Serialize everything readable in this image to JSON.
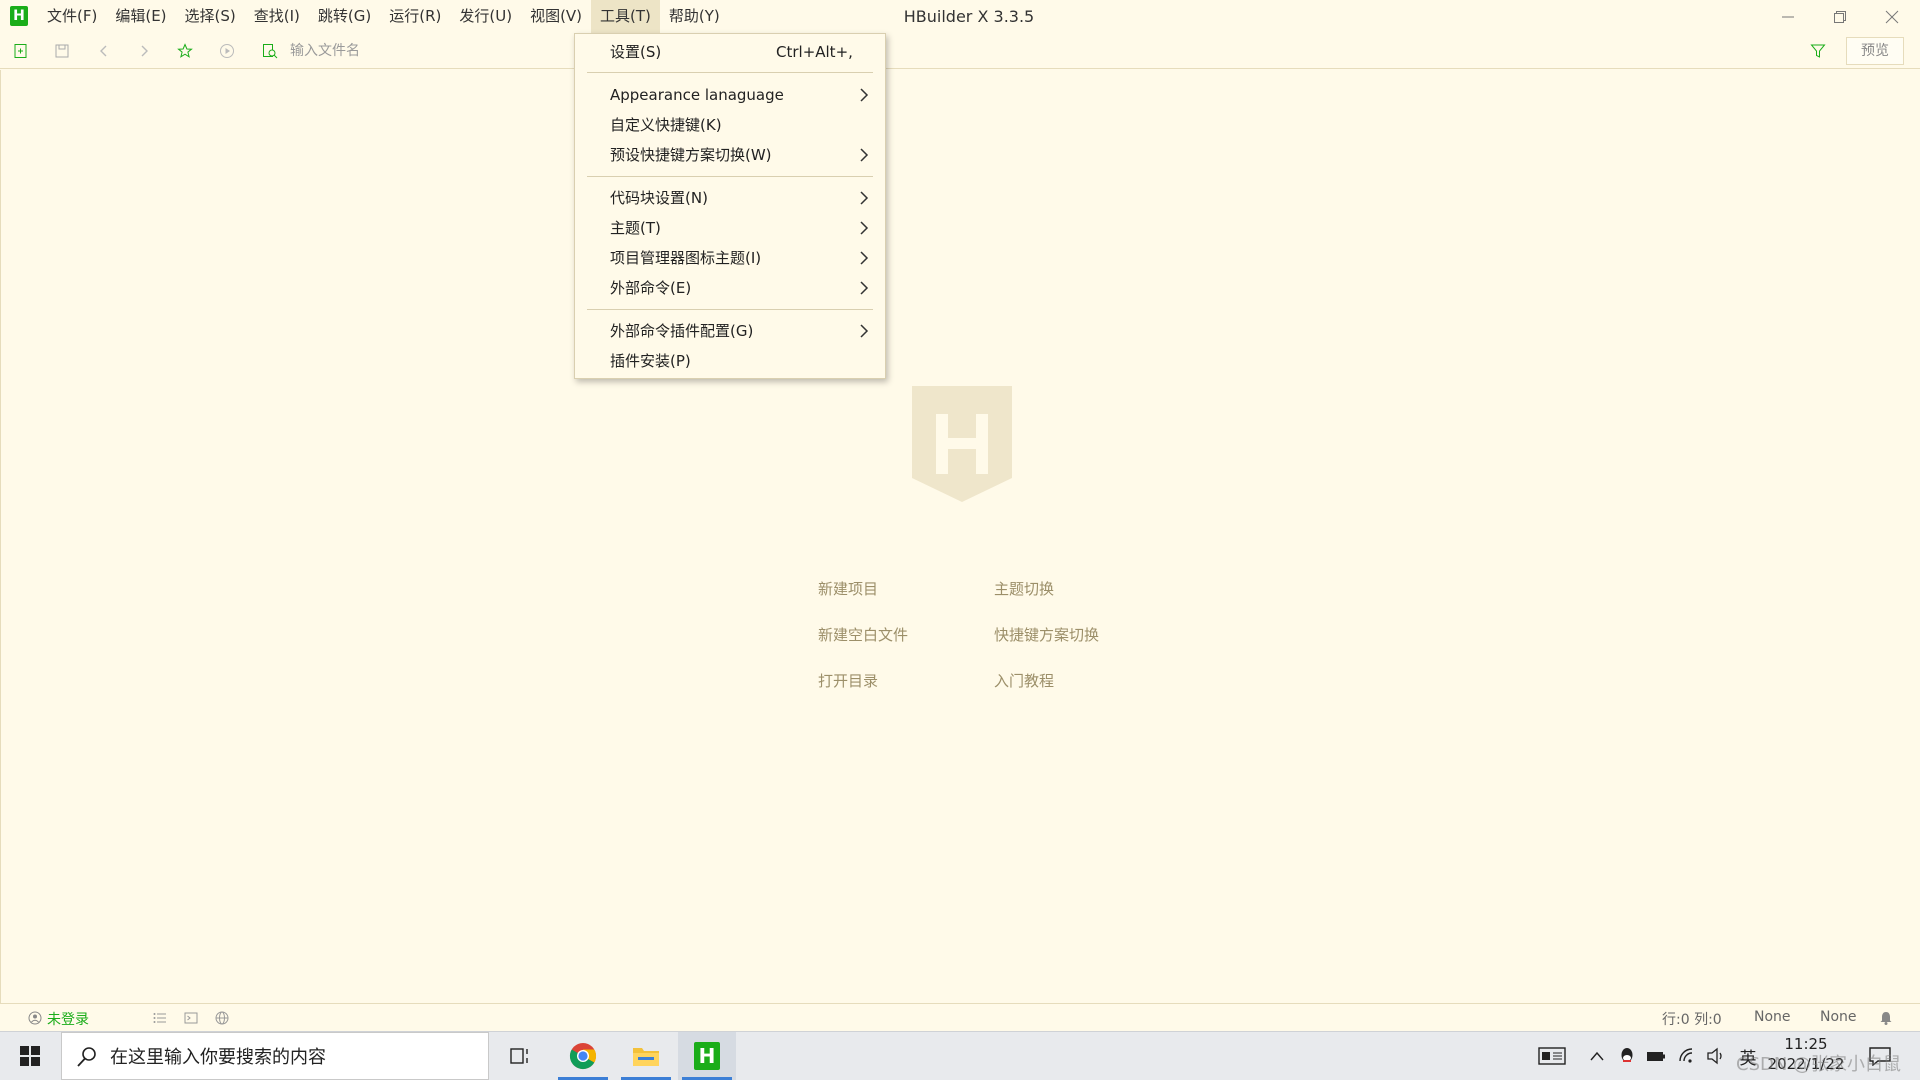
{
  "app": {
    "logo_letter": "H",
    "window_title": "HBuilder X 3.3.5"
  },
  "menubar": {
    "items": [
      {
        "label": "文件(F)"
      },
      {
        "label": "编辑(E)"
      },
      {
        "label": "选择(S)"
      },
      {
        "label": "查找(I)"
      },
      {
        "label": "跳转(G)"
      },
      {
        "label": "运行(R)"
      },
      {
        "label": "发行(U)"
      },
      {
        "label": "视图(V)"
      },
      {
        "label": "工具(T)",
        "active": true
      },
      {
        "label": "帮助(Y)"
      }
    ]
  },
  "toolbar": {
    "file_search_placeholder": "输入文件名",
    "preview_label": "预览"
  },
  "tools_menu": {
    "items": [
      {
        "label": "设置(S)",
        "shortcut": "Ctrl+Alt+,"
      },
      {
        "label": "Appearance lanaguage",
        "submenu": true
      },
      {
        "label": "自定义快捷键(K)"
      },
      {
        "label": "预设快捷键方案切换(W)",
        "submenu": true
      },
      {
        "label": "代码块设置(N)",
        "submenu": true
      },
      {
        "label": "主题(T)",
        "submenu": true
      },
      {
        "label": "项目管理器图标主题(I)",
        "submenu": true
      },
      {
        "label": "外部命令(E)",
        "submenu": true
      },
      {
        "label": "外部命令插件配置(G)",
        "submenu": true
      },
      {
        "label": "插件安装(P)"
      }
    ]
  },
  "welcome": {
    "new_project": "新建项目",
    "new_blank_file": "新建空白文件",
    "open_directory": "打开目录",
    "theme_switch": "主题切换",
    "keymap_switch": "快捷键方案切换",
    "tutorial": "入门教程"
  },
  "statusbar": {
    "login": "未登录",
    "row_col": "行:0  列:0",
    "encoding": "None",
    "syntax": "None"
  },
  "taskbar": {
    "search_placeholder": "在这里输入你要搜索的内容",
    "ime": "英",
    "time": "11:25",
    "date": "2022/1/22",
    "watermark": "CSDN @张家小白鼠"
  },
  "colors": {
    "background": "#fffae9",
    "brand_green": "#1aad19",
    "welcome_link": "#9c8f69",
    "taskbar_active": "#3c7fd6"
  }
}
